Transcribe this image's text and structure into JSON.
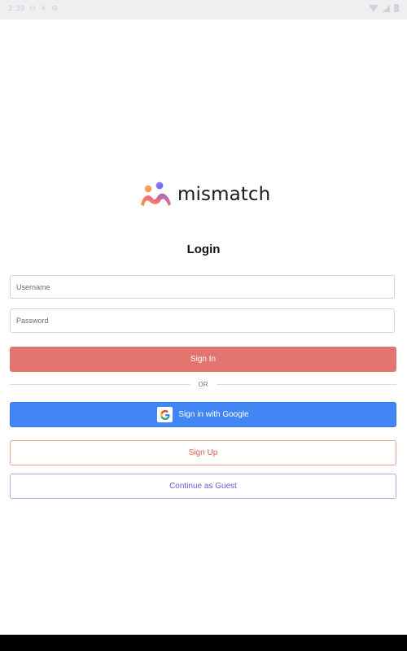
{
  "status_bar": {
    "time": "2:39"
  },
  "logo": {
    "text": "mismatch"
  },
  "login": {
    "title": "Login",
    "username_placeholder": "Username",
    "password_placeholder": "Password",
    "sign_in_label": "Sign In",
    "divider_text": "OR",
    "google_label": "Sign in with Google",
    "sign_up_label": "Sign Up",
    "guest_label": "Continue as Guest"
  },
  "colors": {
    "sign_in": "#e37570",
    "google": "#4285f4",
    "sign_up_border": "#ec9d98",
    "guest_border": "#b3a9ee"
  }
}
